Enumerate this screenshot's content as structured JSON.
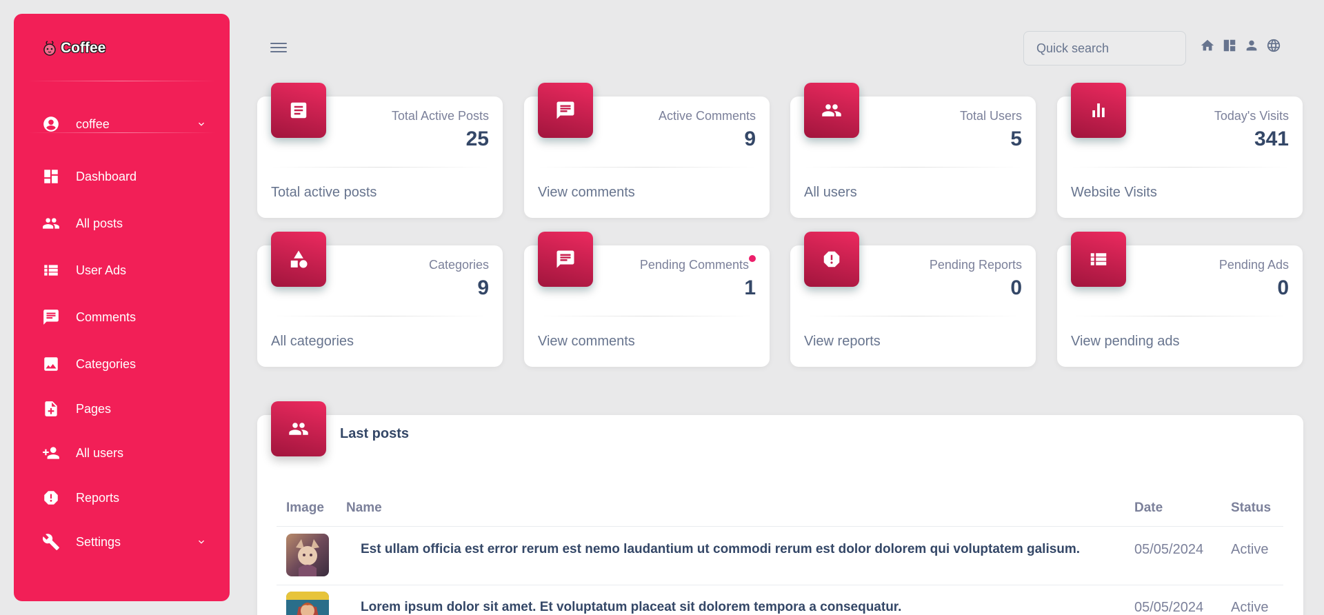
{
  "brand": {
    "name": "Coffee"
  },
  "user": {
    "name": "coffee"
  },
  "sidebar": {
    "items": [
      {
        "label": "Dashboard",
        "icon": "dashboard-icon"
      },
      {
        "label": "All posts",
        "icon": "people-icon"
      },
      {
        "label": "User Ads",
        "icon": "list-icon"
      },
      {
        "label": "Comments",
        "icon": "comment-icon"
      },
      {
        "label": "Categories",
        "icon": "image-icon"
      },
      {
        "label": "Pages",
        "icon": "note-add-icon"
      },
      {
        "label": "All users",
        "icon": "person-add-icon"
      },
      {
        "label": "Reports",
        "icon": "report-icon"
      },
      {
        "label": "Settings",
        "icon": "wrench-icon"
      }
    ]
  },
  "search": {
    "placeholder": "Quick search"
  },
  "stats": [
    {
      "label": "Total Active Posts",
      "value": "25",
      "link": "Total active posts",
      "icon": "article-icon"
    },
    {
      "label": "Active Comments",
      "value": "9",
      "link": "View comments",
      "icon": "comment-icon"
    },
    {
      "label": "Total Users",
      "value": "5",
      "link": "All users",
      "icon": "group-icon"
    },
    {
      "label": "Today's Visits",
      "value": "341",
      "link": "Website Visits",
      "icon": "bar-chart-icon"
    },
    {
      "label": "Categories",
      "value": "9",
      "link": "All categories",
      "icon": "category-icon"
    },
    {
      "label": "Pending Comments",
      "value": "1",
      "link": "View comments",
      "icon": "comment-icon"
    },
    {
      "label": "Pending Reports",
      "value": "0",
      "link": "View reports",
      "icon": "report-icon"
    },
    {
      "label": "Pending Ads",
      "value": "0",
      "link": "View pending ads",
      "icon": "list-icon"
    }
  ],
  "last_posts": {
    "title": "Last posts",
    "columns": [
      "Image",
      "Name",
      "Date",
      "Status"
    ],
    "rows": [
      {
        "name": "Est ullam officia est error rerum est nemo laudantium ut commodi rerum est dolor dolorem qui voluptatem galisum.",
        "date": "05/05/2024",
        "status": "Active"
      },
      {
        "name": "Lorem ipsum dolor sit amet. Et voluptatum placeat sit dolorem tempora a consequatur.",
        "date": "05/05/2024",
        "status": "Active"
      }
    ]
  },
  "colors": {
    "sidebar": "#f21f57",
    "accent_dark": "#a1153d",
    "text": "#344767",
    "muted": "#7b809a",
    "background": "#e9e9ea"
  }
}
